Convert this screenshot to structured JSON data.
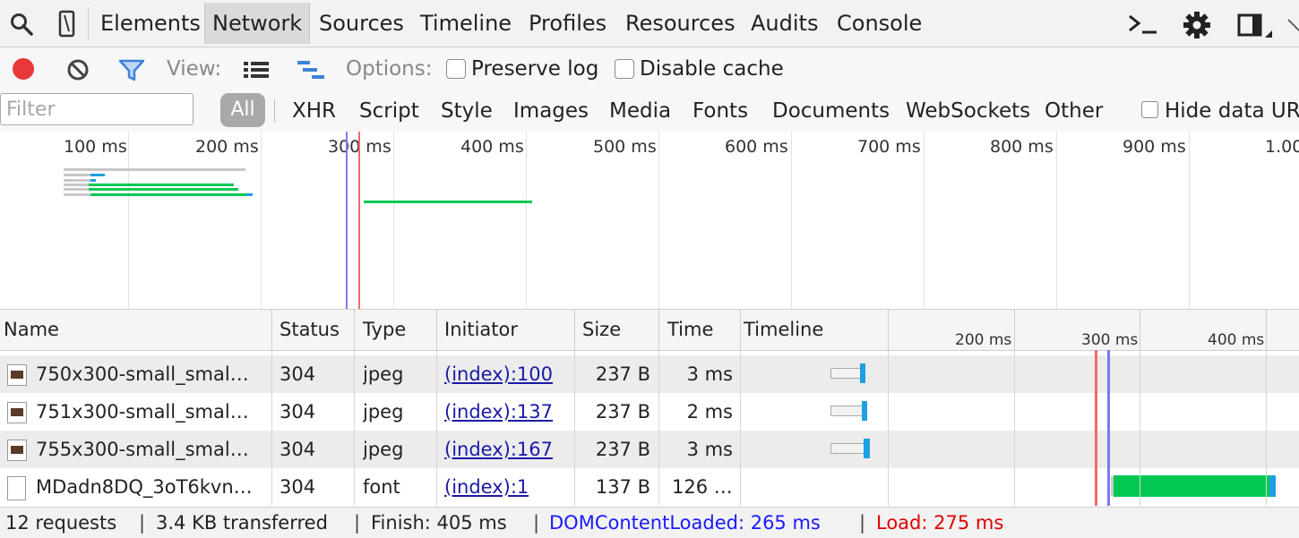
{
  "tabs": [
    "Elements",
    "Network",
    "Sources",
    "Timeline",
    "Profiles",
    "Resources",
    "Audits",
    "Console"
  ],
  "selected_tab": "Network",
  "icons": {
    "search": "search-icon",
    "device": "device-mode-icon",
    "console": "console-drawer-icon",
    "settings": "gear-icon",
    "dock": "dock-side-icon",
    "more": "more-icon",
    "record": "record-icon",
    "clear": "clear-icon",
    "filter": "filter-icon",
    "large_rows": "large-rows-icon",
    "overview": "overview-icon",
    "close": "close-icon"
  },
  "colors": {
    "record": "#e8383a",
    "filter_icon": "#3d82d6",
    "dom_content_loaded": "#7a7af0",
    "load": "#f26a6a",
    "waiting": "#00c853",
    "receiving": "#1ea0e0",
    "link": "#1a1aa6",
    "status_dcl": "#1a1aff",
    "status_load": "#e00000"
  },
  "toolbar": {
    "view_label": "View:",
    "options_label": "Options:",
    "preserve_log": "Preserve log",
    "preserve_log_checked": false,
    "disable_cache": "Disable cache",
    "disable_cache_checked": false
  },
  "filter": {
    "placeholder": "Filter",
    "value": "",
    "selected_type": "All",
    "types": [
      "XHR",
      "Script",
      "Style",
      "Images",
      "Media",
      "Fonts",
      "Documents",
      "WebSockets",
      "Other"
    ],
    "hide_data_urls": "Hide data UR",
    "hide_data_urls_checked": false
  },
  "overview": {
    "ticks": [
      "100 ms",
      "200 ms",
      "300 ms",
      "400 ms",
      "500 ms",
      "600 ms",
      "700 ms",
      "800 ms",
      "900 ms",
      "1.00"
    ]
  },
  "table": {
    "columns": [
      "Name",
      "Status",
      "Type",
      "Initiator",
      "Size",
      "Time",
      "Timeline"
    ],
    "timeline_ticks": [
      "200 ms",
      "300 ms",
      "400 ms"
    ],
    "rows": [
      {
        "name": "750x300-small_smal…",
        "status": "304",
        "type": "jpeg",
        "initiator": "(index):100",
        "size": "237 B",
        "time": "3 ms",
        "icon": "image-thumbnail-icon"
      },
      {
        "name": "751x300-small_smal…",
        "status": "304",
        "type": "jpeg",
        "initiator": "(index):137",
        "size": "237 B",
        "time": "2 ms",
        "icon": "image-thumbnail-icon"
      },
      {
        "name": "755x300-small_smal…",
        "status": "304",
        "type": "jpeg",
        "initiator": "(index):167",
        "size": "237 B",
        "time": "3 ms",
        "icon": "image-thumbnail-icon"
      },
      {
        "name": "MDadn8DQ_3oT6kvn…",
        "status": "304",
        "type": "font",
        "initiator": "(index):1",
        "size": "137 B",
        "time": "126 …",
        "icon": "document-icon"
      }
    ]
  },
  "status": {
    "requests": "12 requests",
    "transferred": "3.4 KB transferred",
    "finish": "Finish: 405 ms",
    "dom_content_loaded": "DOMContentLoaded: 265 ms",
    "load": "Load: 275 ms",
    "separator": "|"
  }
}
